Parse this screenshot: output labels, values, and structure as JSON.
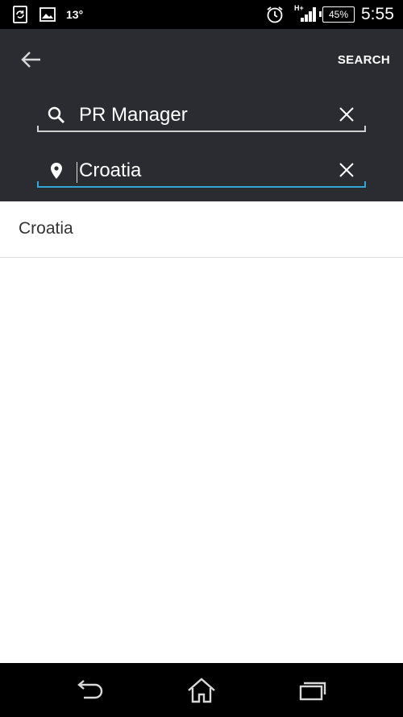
{
  "status_bar": {
    "temperature": "13°",
    "network": "H+",
    "battery": "45%",
    "time": "5:55"
  },
  "header": {
    "search_label": "SEARCH",
    "keyword_field": {
      "value": "PR Manager"
    },
    "location_field": {
      "value": "Croatia"
    }
  },
  "suggestions": [
    {
      "label": "Croatia"
    }
  ],
  "colors": {
    "header_bg": "#2a2c31",
    "active_underline": "#33a6d8",
    "inactive_underline": "#d0d0d0"
  }
}
